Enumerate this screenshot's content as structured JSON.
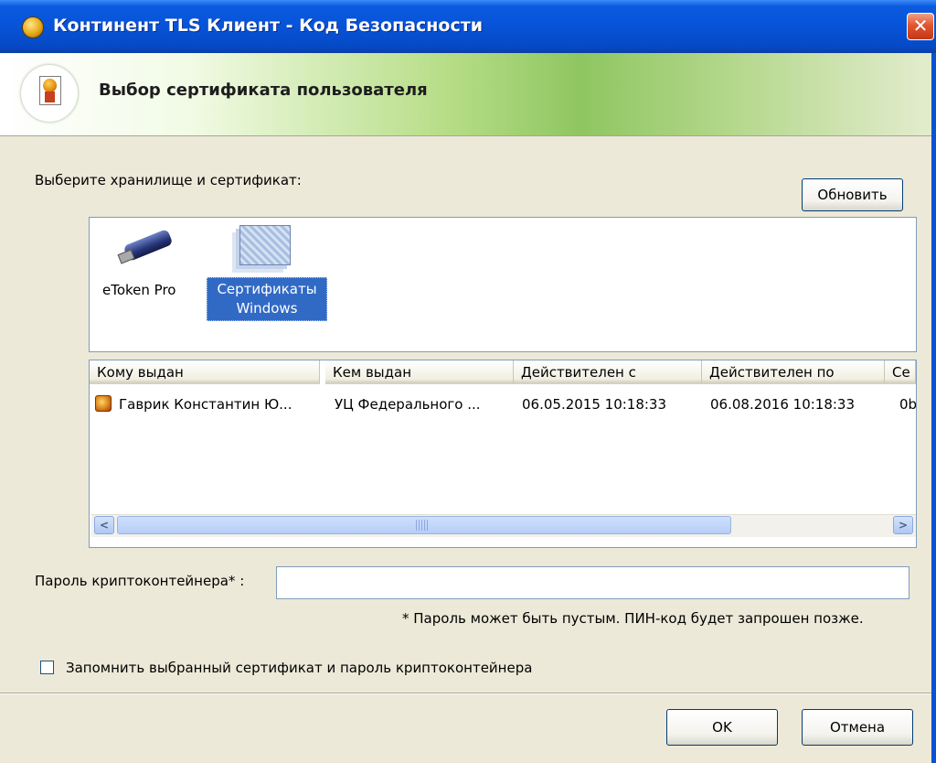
{
  "window": {
    "title": "Континент TLS Клиент - Код Безопасности",
    "close_symbol": "✕",
    "app_icon": "app-shield-icon"
  },
  "header": {
    "title": "Выбор сертификата пользователя",
    "icon": "certificate-icon"
  },
  "store": {
    "label": "Выберите хранилище и сертификат:",
    "refresh_label": "Обновить",
    "items": [
      {
        "label": "eToken Pro",
        "icon": "usb-token-icon",
        "selected": false
      },
      {
        "label": "Сертификаты Windows",
        "icon": "windows-certificates-icon",
        "selected": true
      }
    ]
  },
  "cert_table": {
    "columns": [
      "Кому выдан",
      "Кем выдан",
      "Действителен с",
      "Действителен по",
      "Се"
    ],
    "rows": [
      [
        "Гаврик Константин Ю...",
        "УЦ Федерального ...",
        "06.05.2015 10:18:33",
        "06.08.2016 10:18:33",
        "0b"
      ]
    ],
    "scroll_left_symbol": "<",
    "scroll_right_symbol": ">",
    "scroll_grip_symbol": "III"
  },
  "password": {
    "label": "Пароль криптоконтейнера* :",
    "value": "",
    "hint": "* Пароль может быть пустым. ПИН-код будет запрошен позже."
  },
  "remember": {
    "label": "Запомнить выбранный сертификат и пароль криптоконтейнера",
    "checked": false
  },
  "buttons": {
    "ok": "OK",
    "cancel": "Отмена"
  },
  "colors": {
    "titlebar": "#0753d8",
    "selection": "#316ac5",
    "dialog_bg": "#ece9d8",
    "close_button": "#e2552e"
  }
}
